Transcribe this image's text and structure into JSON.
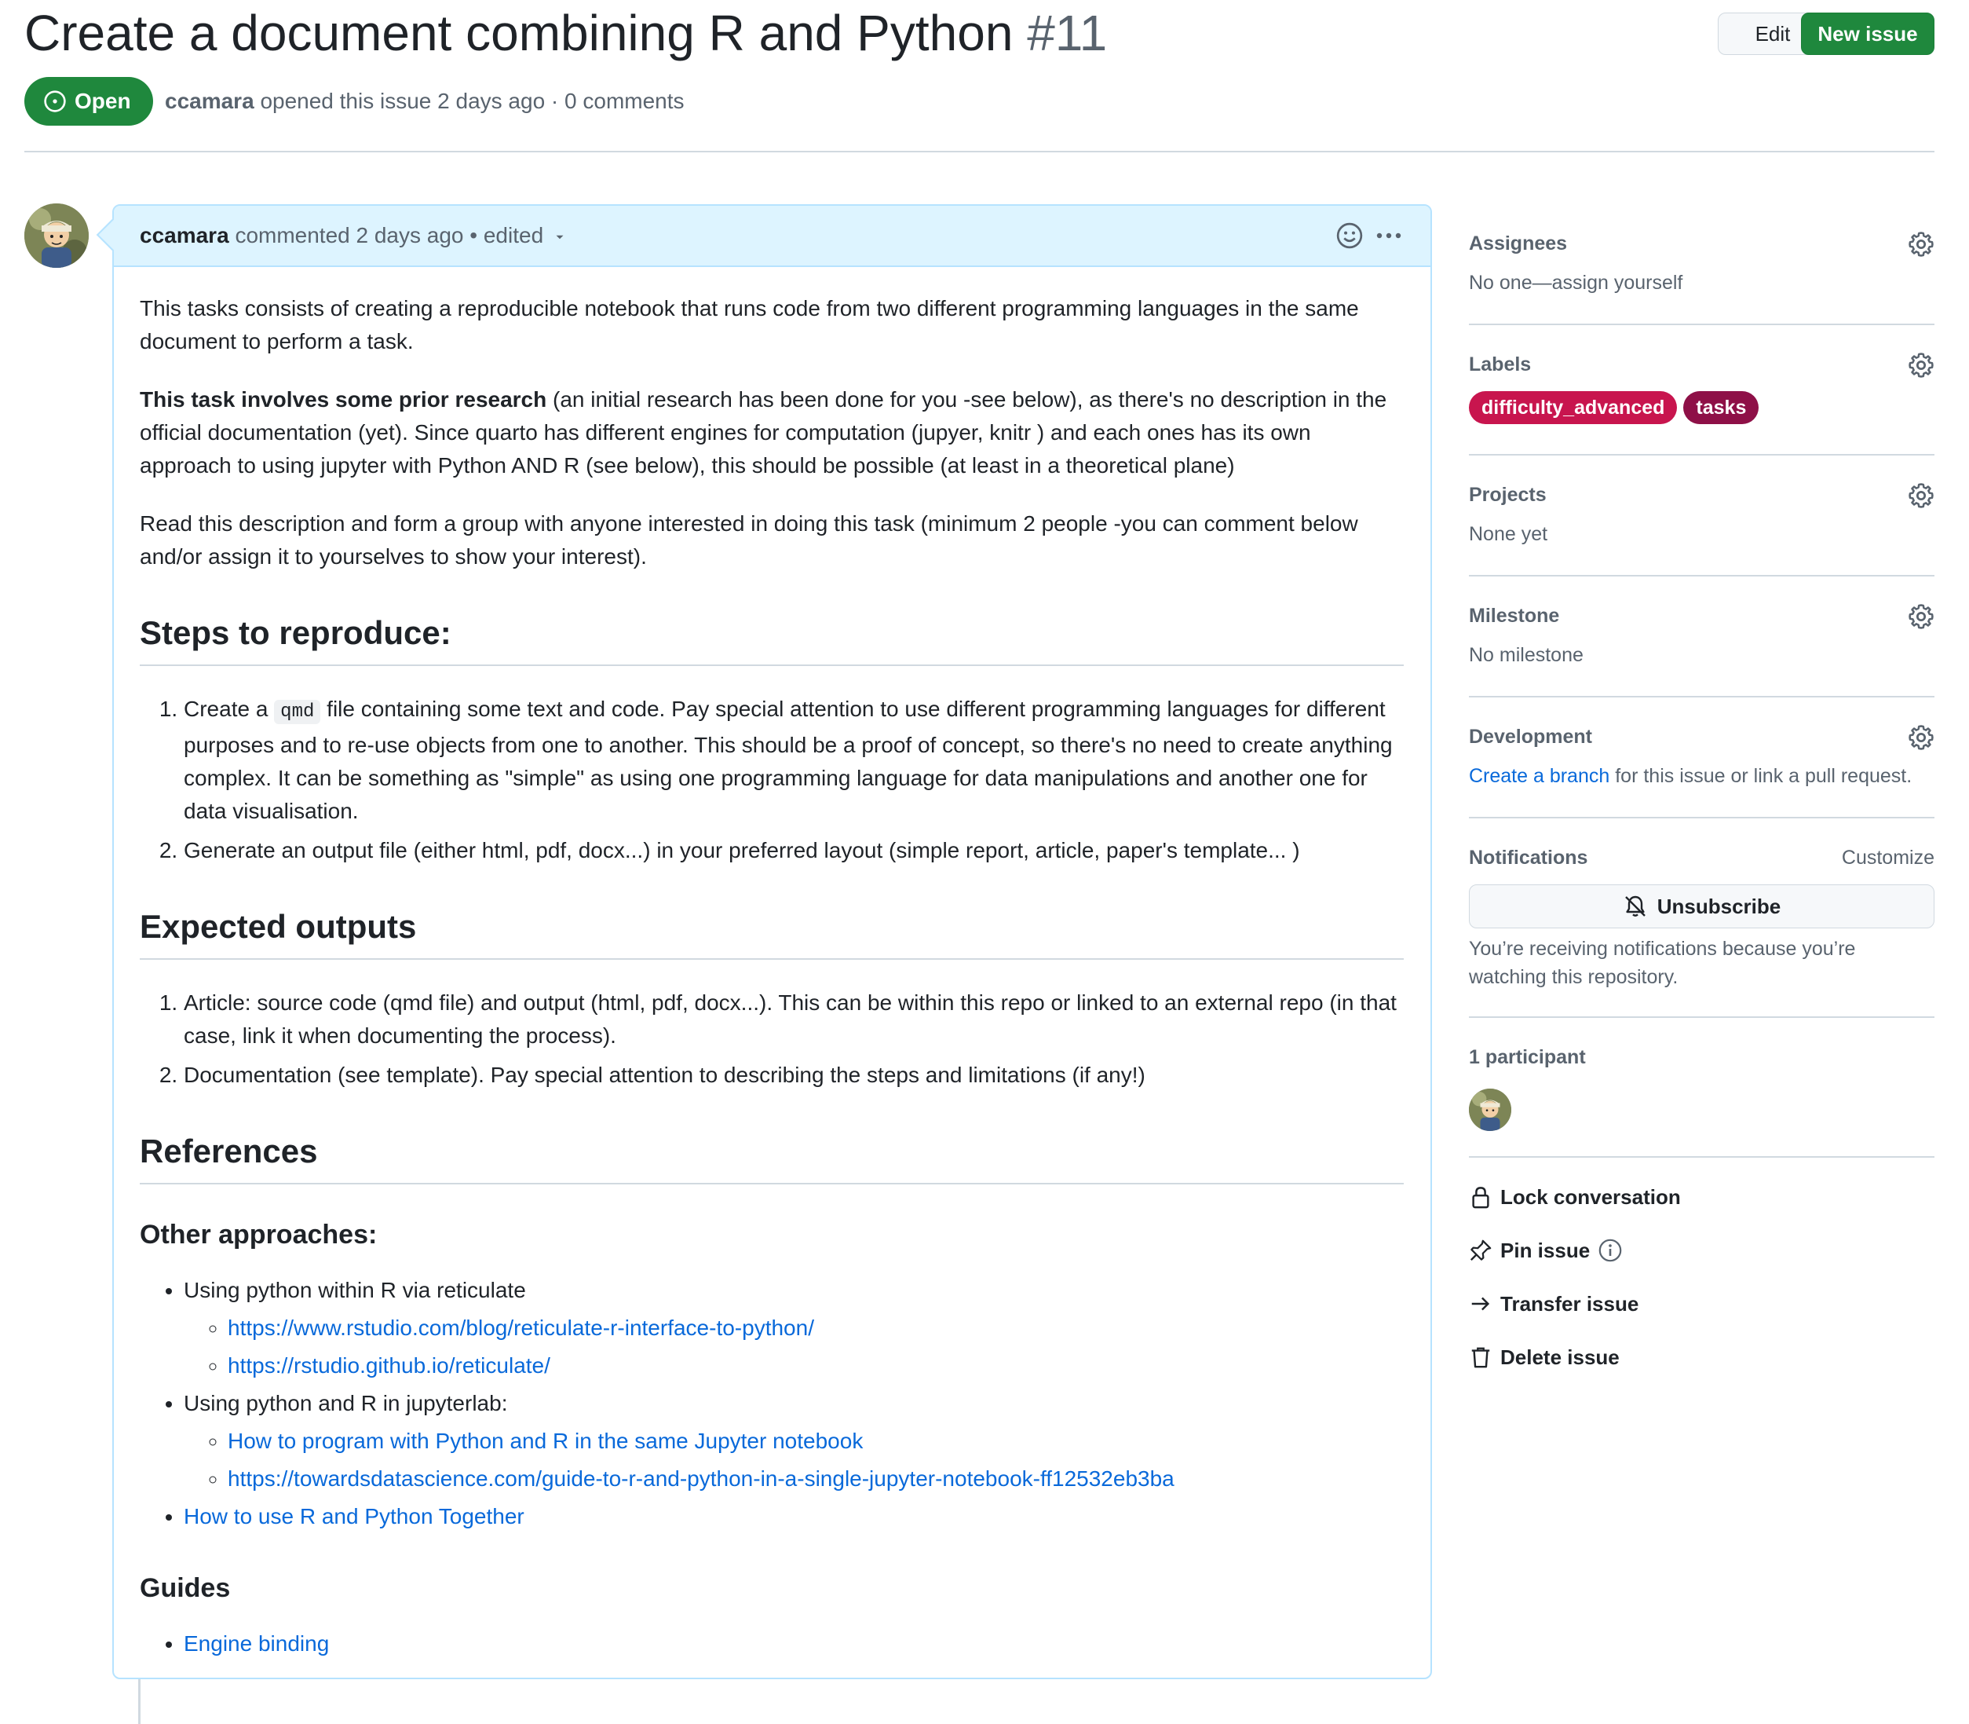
{
  "issue": {
    "title": "Create a document combining R and Python",
    "number": "#11",
    "state": "Open",
    "author": "ccamara",
    "meta_rest": "opened this issue 2 days ago · 0 comments"
  },
  "header_actions": {
    "edit_label": "Edit",
    "new_issue_label": "New issue"
  },
  "comment": {
    "author": "ccamara",
    "action": "commented 2 days ago",
    "edited": "• edited",
    "p1": "This tasks consists of creating a reproducible notebook that runs code from two different programming languages in the same document to perform a task.",
    "p2_bold": "This task involves some prior research",
    "p2_rest": " (an initial research has been done for you -see below), as there's no description in the official documentation (yet). Since quarto has different engines for computation (jupyer, knitr ) and each ones has its own approach to using jupyter with Python AND R (see below), this should be possible (at least in a theoretical plane)",
    "p3": "Read this description and form a group with anyone interested in doing this task (minimum 2 people -you can comment below and/or assign it to yourselves to show your interest).",
    "h_steps": "Steps to reproduce:",
    "step1_a": "Create a ",
    "step1_code": "qmd",
    "step1_b": " file containing some text and code. Pay special attention to use different programming languages for different purposes and to re-use objects from one to another. This should be a proof of concept, so there's no need to create anything complex. It can be something as \"simple\" as using one programming language for data manipulations and another one for data visualisation.",
    "step2": "Generate an output file (either html, pdf, docx...) in your preferred layout (simple report, article, paper's template... )",
    "h_outputs": "Expected outputs",
    "out1": "Article: source code (qmd file) and output (html, pdf, docx...). This can be within this repo or linked to an external repo (in that case, link it when documenting the process).",
    "out2": "Documentation (see template). Pay special attention to describing the steps and limitations (if any!)",
    "h_refs": "References",
    "h_other": "Other approaches:",
    "ref1": "Using python within R via reticulate",
    "ref1_link1": "https://www.rstudio.com/blog/reticulate-r-interface-to-python/",
    "ref1_link2": "https://rstudio.github.io/reticulate/",
    "ref2": "Using python and R in jupyterlab:",
    "ref2_link1": "How to program with Python and R in the same Jupyter notebook",
    "ref2_link2": "https://towardsdatascience.com/guide-to-r-and-python-in-a-single-jupyter-notebook-ff12532eb3ba",
    "ref3_link": "How to use R and Python Together",
    "h_guides": "Guides",
    "guide1_link": "Engine binding"
  },
  "sidebar": {
    "assignees_title": "Assignees",
    "assignees_value": "No one—assign yourself",
    "labels_title": "Labels",
    "labels": [
      {
        "name": "difficulty_advanced",
        "color": "#c8154e"
      },
      {
        "name": "tasks",
        "color": "#8e1047"
      }
    ],
    "projects_title": "Projects",
    "projects_value": "None yet",
    "milestone_title": "Milestone",
    "milestone_value": "No milestone",
    "development_title": "Development",
    "development_link": "Create a branch",
    "development_rest": " for this issue or link a pull request.",
    "notifications_title": "Notifications",
    "customize_label": "Customize",
    "unsubscribe_label": "Unsubscribe",
    "notifications_note": "You’re receiving notifications because you’re watching this repository.",
    "participants_title": "1 participant",
    "lock_label": "Lock conversation",
    "pin_label": "Pin issue",
    "transfer_label": "Transfer issue",
    "delete_label": "Delete issue"
  },
  "icons": {
    "state": "issue-opened-icon",
    "gear": "gear-icon",
    "smiley": "smiley-icon",
    "kebab": "kebab-horizontal-icon",
    "bell": "bell-slash-icon",
    "lock": "lock-icon",
    "pin": "pin-icon",
    "info": "info-icon",
    "arrow": "arrow-right-icon",
    "trash": "trash-icon"
  }
}
